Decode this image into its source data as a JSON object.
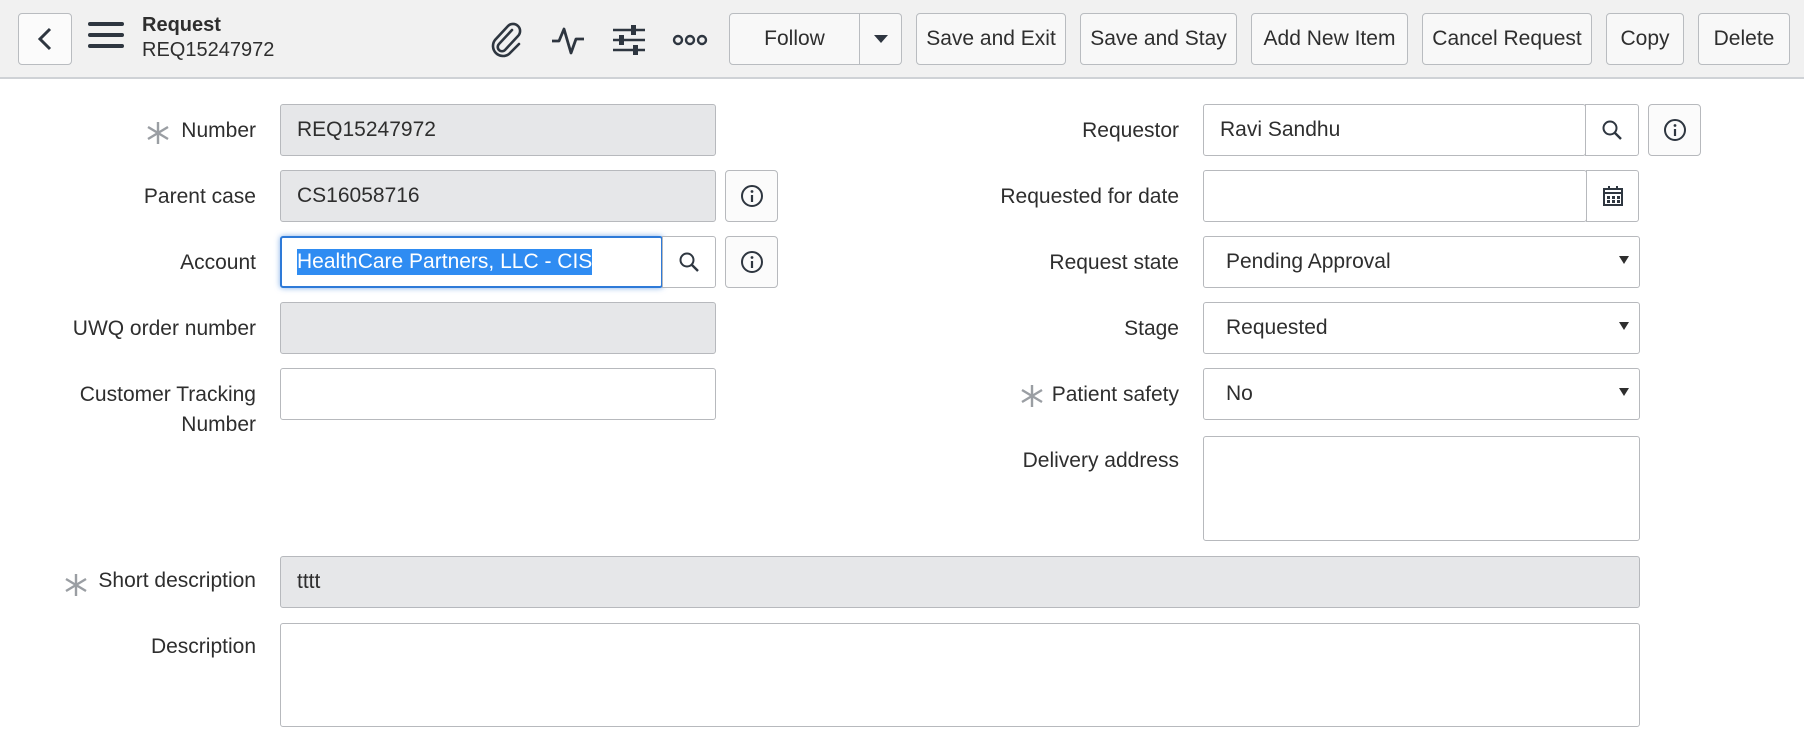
{
  "header": {
    "title": "Request",
    "record_number": "REQ15247972",
    "follow_label": "Follow",
    "buttons": {
      "save_exit": "Save and Exit",
      "save_stay": "Save and Stay",
      "add_new_item": "Add New Item",
      "cancel_request": "Cancel Request",
      "copy": "Copy",
      "delete": "Delete"
    },
    "icons": [
      "back-arrow-icon",
      "hamburger-menu-icon",
      "paperclip-icon",
      "activity-pulse-icon",
      "sliders-icon",
      "more-options-icon",
      "chevron-down-icon"
    ]
  },
  "form": {
    "number": {
      "label": "Number",
      "value": "REQ15247972",
      "required": true
    },
    "parent_case": {
      "label": "Parent case",
      "value": "CS16058716"
    },
    "account": {
      "label": "Account",
      "value": "HealthCare Partners, LLC - CIS"
    },
    "uwq_order_number": {
      "label": "UWQ order number",
      "value": ""
    },
    "customer_tracking": {
      "label_line1": "Customer Tracking",
      "label_line2": "Number",
      "value": ""
    },
    "requestor": {
      "label": "Requestor",
      "value": "Ravi Sandhu"
    },
    "requested_for_date": {
      "label": "Requested for date",
      "value": ""
    },
    "request_state": {
      "label": "Request state",
      "value": "Pending Approval"
    },
    "stage": {
      "label": "Stage",
      "value": "Requested"
    },
    "patient_safety": {
      "label": "Patient safety",
      "value": "No",
      "required": true
    },
    "delivery_address": {
      "label": "Delivery address",
      "value": ""
    },
    "short_description": {
      "label": "Short description",
      "value": "tttt",
      "required": true
    },
    "description": {
      "label": "Description",
      "value": ""
    }
  },
  "colors": {
    "header_bg": "#f1f1f1",
    "readonly_bg": "#e6e7e9",
    "focus_border": "#2e7ad8",
    "selection_bg": "#2f8cf2"
  }
}
